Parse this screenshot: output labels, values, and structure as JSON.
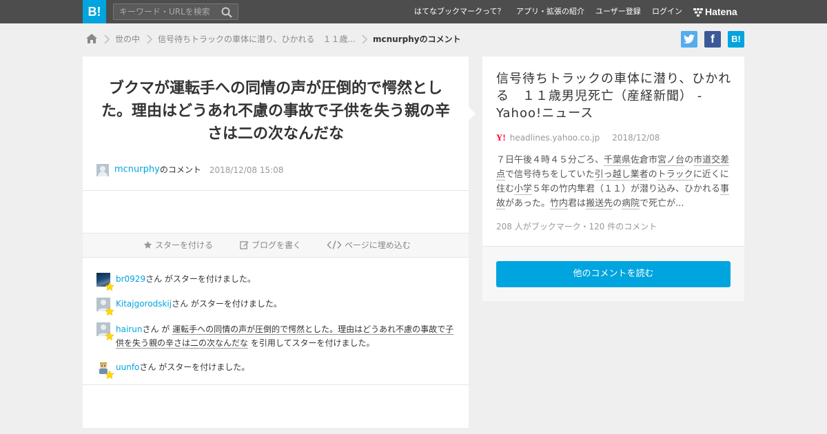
{
  "header": {
    "logo": "B!",
    "search_placeholder": "キーワード・URLを検索",
    "nav": [
      "はてなブックマークって？",
      "アプリ・拡張の紹介",
      "ユーザー登録",
      "ログイン"
    ],
    "brand": "Hatena"
  },
  "breadcrumb": {
    "items": [
      "世の中",
      "信号待ちトラックの車体に潜り、ひかれる　１１歳..."
    ],
    "current": "mcnurphyのコメント"
  },
  "social": {
    "twitter": "t",
    "facebook": "f",
    "hatena": "B!"
  },
  "comment": {
    "text": "ブクマが運転手への同情の声が圧倒的で愕然とした。理由はどうあれ不慮の事故で子供を失う親の辛さは二の次なんだな",
    "user": "mcnurphy",
    "user_suffix": "のコメント",
    "datetime": "2018/12/08 15:08"
  },
  "actions": {
    "star": "スターを付ける",
    "blog": "ブログを書く",
    "embed": "ページに埋め込む"
  },
  "stars": [
    {
      "user": "br0929",
      "text": "さん がスターを付けました。"
    },
    {
      "user": "Kitajgorodskij",
      "text": "さん がスターを付けました。"
    },
    {
      "user": "hairun",
      "text_before": "さん が ",
      "quote_line1": "運転手への同情の声が圧倒的で愕然とした。理由はどうあれ不慮の事故で子",
      "quote_line2": "供を失う親の辛さは二の次なんだな",
      "text_after": " を引用してスターを付けました。"
    },
    {
      "user": "uunfo",
      "text": "さん がスターを付けました。"
    }
  ],
  "entry": {
    "title": "信号待ちトラックの車体に潜り、ひかれる　１１歳男児死亡（産経新聞） - Yahoo!ニュース",
    "favicon": "Y!",
    "domain": "headlines.yahoo.co.jp",
    "date": "2018/12/08",
    "body": [
      {
        "t": "７日午後４時４５分ごろ、"
      },
      {
        "t": "千葉県",
        "kw": true
      },
      {
        "t": "佐倉市"
      },
      {
        "t": "宮ノ台",
        "kw": true
      },
      {
        "t": "の"
      },
      {
        "t": "市道",
        "kw": true
      },
      {
        "t": "交差点",
        "kw": true
      },
      {
        "t": "で信号待ちをしていた"
      },
      {
        "t": "引っ越し業者",
        "kw": true
      },
      {
        "t": "の"
      },
      {
        "t": "トラック",
        "kw": true
      },
      {
        "t": "に近くに住む"
      },
      {
        "t": "小学",
        "kw": true
      },
      {
        "t": "５年の竹内隼君（１１）が潜り込み、ひかれる"
      },
      {
        "t": "事故",
        "kw": true
      },
      {
        "t": "があった。"
      },
      {
        "t": "竹内",
        "kw": true
      },
      {
        "t": "君は"
      },
      {
        "t": "搬送先",
        "kw": true
      },
      {
        "t": "の"
      },
      {
        "t": "病院",
        "kw": true
      },
      {
        "t": "で死亡が..."
      }
    ],
    "stats": "208 人がブックマーク・120 件のコメント",
    "read_more": "他のコメントを読む"
  },
  "colors": {
    "accent": "#00a4de",
    "topbar": "#4d4d4d",
    "star": "#ffd900",
    "twitter": "#55acee",
    "facebook": "#3b5998"
  }
}
